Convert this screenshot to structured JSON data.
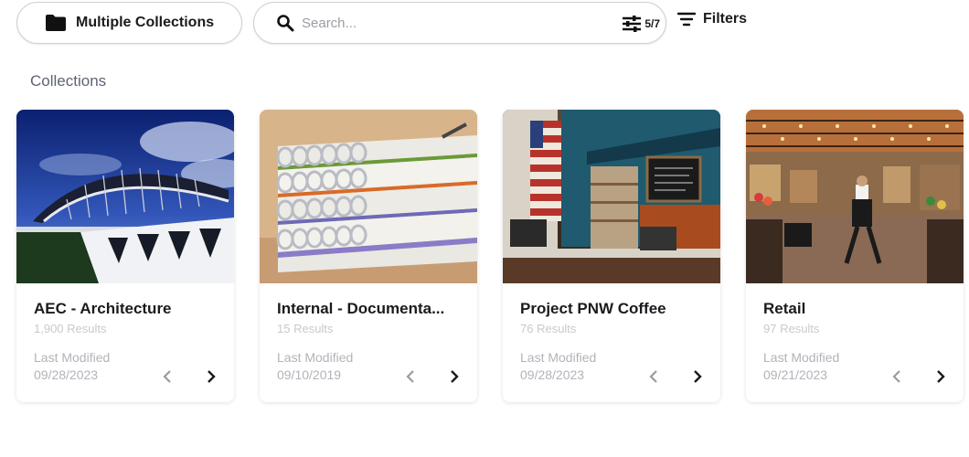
{
  "toolbar": {
    "collections_label": "Multiple Collections",
    "search_placeholder": "Search...",
    "search_value": "",
    "result_count": "5/7",
    "filters_label": "Filters"
  },
  "section_title": "Collections",
  "cards": [
    {
      "title": "AEC - Architecture",
      "results": "1,900 Results",
      "last_modified_label": "Last Modified",
      "last_modified": "09/28/2023"
    },
    {
      "title": "Internal - Documenta...",
      "results": "15 Results",
      "last_modified_label": "Last Modified",
      "last_modified": "09/10/2019"
    },
    {
      "title": "Project PNW Coffee",
      "results": "76 Results",
      "last_modified_label": "Last Modified",
      "last_modified": "09/28/2023"
    },
    {
      "title": "Retail",
      "results": "97 Results",
      "last_modified_label": "Last Modified",
      "last_modified": "09/21/2023"
    }
  ]
}
